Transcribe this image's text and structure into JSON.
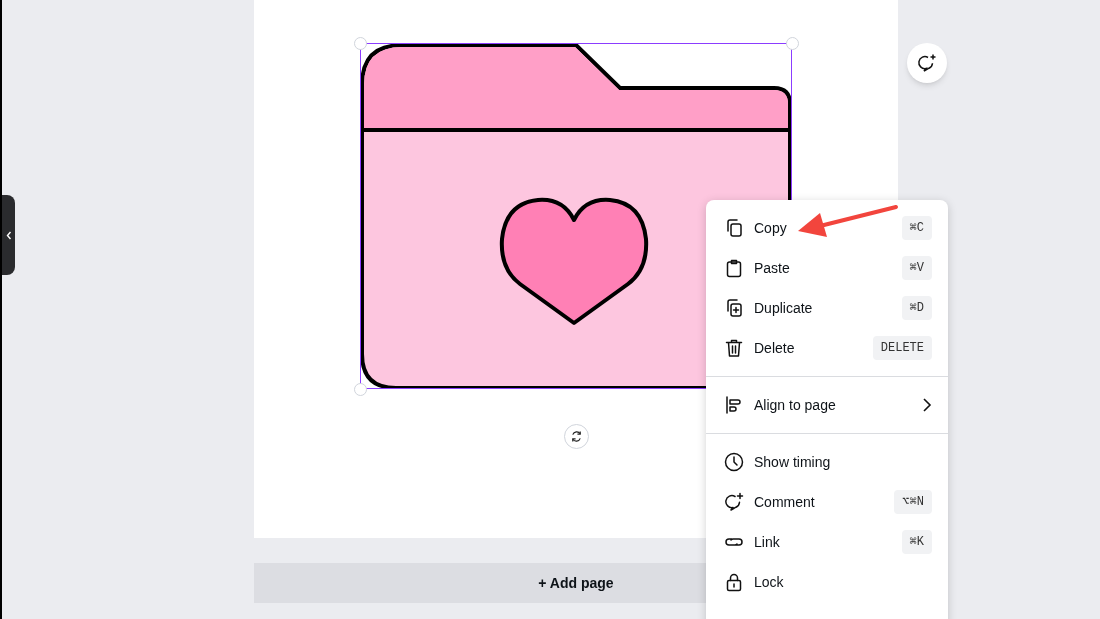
{
  "canvas": {
    "add_page_button": "+ Add page"
  },
  "context_menu": {
    "sections": [
      [
        {
          "label": "Copy",
          "shortcut": "⌘C",
          "kind": "action"
        },
        {
          "label": "Paste",
          "shortcut": "⌘V",
          "kind": "action"
        },
        {
          "label": "Duplicate",
          "shortcut": "⌘D",
          "kind": "action"
        },
        {
          "label": "Delete",
          "shortcut": "DELETE",
          "kind": "action"
        }
      ],
      [
        {
          "label": "Align to page",
          "kind": "submenu"
        }
      ],
      [
        {
          "label": "Show timing",
          "kind": "action"
        },
        {
          "label": "Comment",
          "shortcut": "⌥⌘N",
          "kind": "action"
        },
        {
          "label": "Link",
          "shortcut": "⌘K",
          "kind": "action"
        },
        {
          "label": "Lock",
          "kind": "action"
        }
      ]
    ]
  }
}
